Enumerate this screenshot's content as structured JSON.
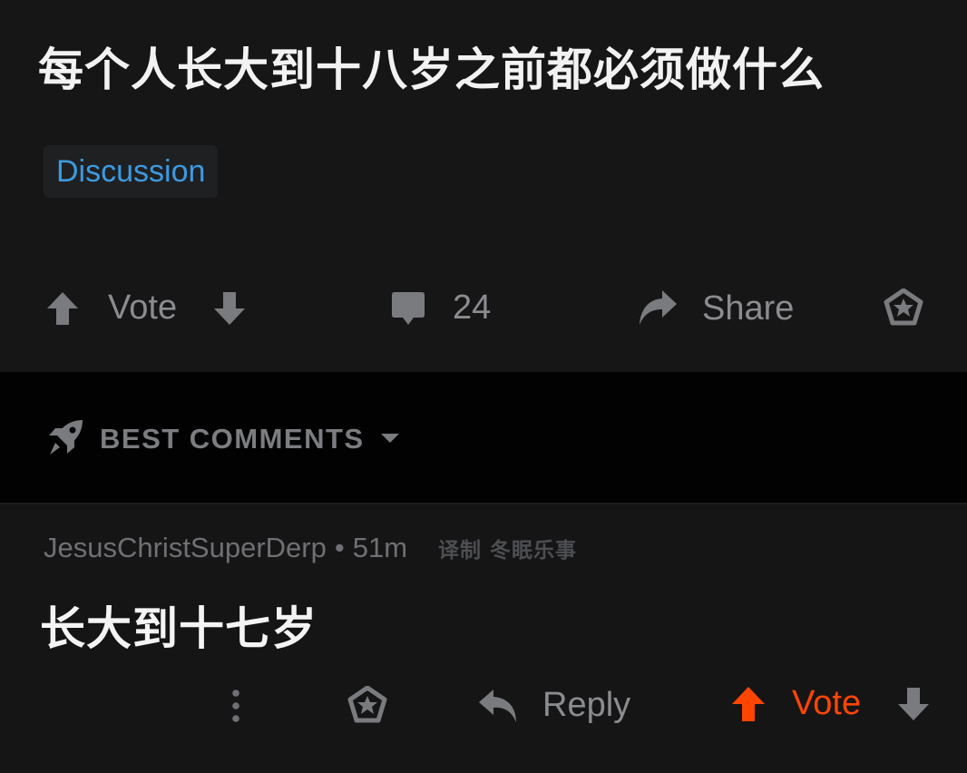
{
  "post": {
    "title": "每个人长大到十八岁之前都必须做什么",
    "flair": "Discussion",
    "vote_label": "Vote",
    "comment_count": "24",
    "share_label": "Share"
  },
  "sort": {
    "label": "BEST COMMENTS"
  },
  "comment": {
    "author": "JesusChristSuperDerp",
    "separator": "•",
    "age": "51m",
    "watermark": "译制 冬眠乐事",
    "body": "长大到十七岁",
    "reply_label": "Reply",
    "vote_label": "Vote"
  },
  "colors": {
    "background": "#161617",
    "sort_bar": "#020202",
    "muted": "#8b8c8f",
    "flair_text": "#3d9ae0",
    "upvote_active": "#ff4500"
  },
  "icons": {
    "upvote": "arrow-up-icon",
    "downvote": "arrow-down-icon",
    "comment": "speech-bubble-icon",
    "share": "share-arrow-icon",
    "award": "award-icon",
    "sort": "rocket-icon",
    "dropdown": "caret-down-icon",
    "more": "vertical-dots-icon",
    "reply": "reply-arrow-icon"
  }
}
